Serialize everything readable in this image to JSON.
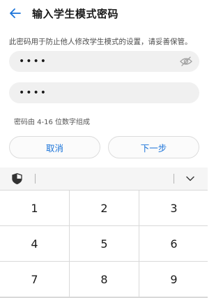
{
  "header": {
    "back_icon": "back-arrow-icon",
    "title": "输入学生模式密码"
  },
  "description": "此密码用于防止他人修改学生模式的设置，请妥善保管。",
  "password_field": {
    "value": "••••",
    "toggle_icon": "eye-off-icon"
  },
  "confirm_field": {
    "value": "••••"
  },
  "hint": "密码由 4-16 位数字组成",
  "buttons": {
    "cancel": "取消",
    "next": "下一步"
  },
  "keyboard": {
    "toolbar_icons": [
      "shield-icon",
      "chevron-down-icon"
    ],
    "keys": [
      "1",
      "2",
      "3",
      "4",
      "5",
      "6",
      "7",
      "8",
      "9"
    ]
  },
  "colors": {
    "accent": "#1a73d9",
    "field_bg": "#f0f0f0",
    "keyboard_bg": "#d9d9d9"
  }
}
